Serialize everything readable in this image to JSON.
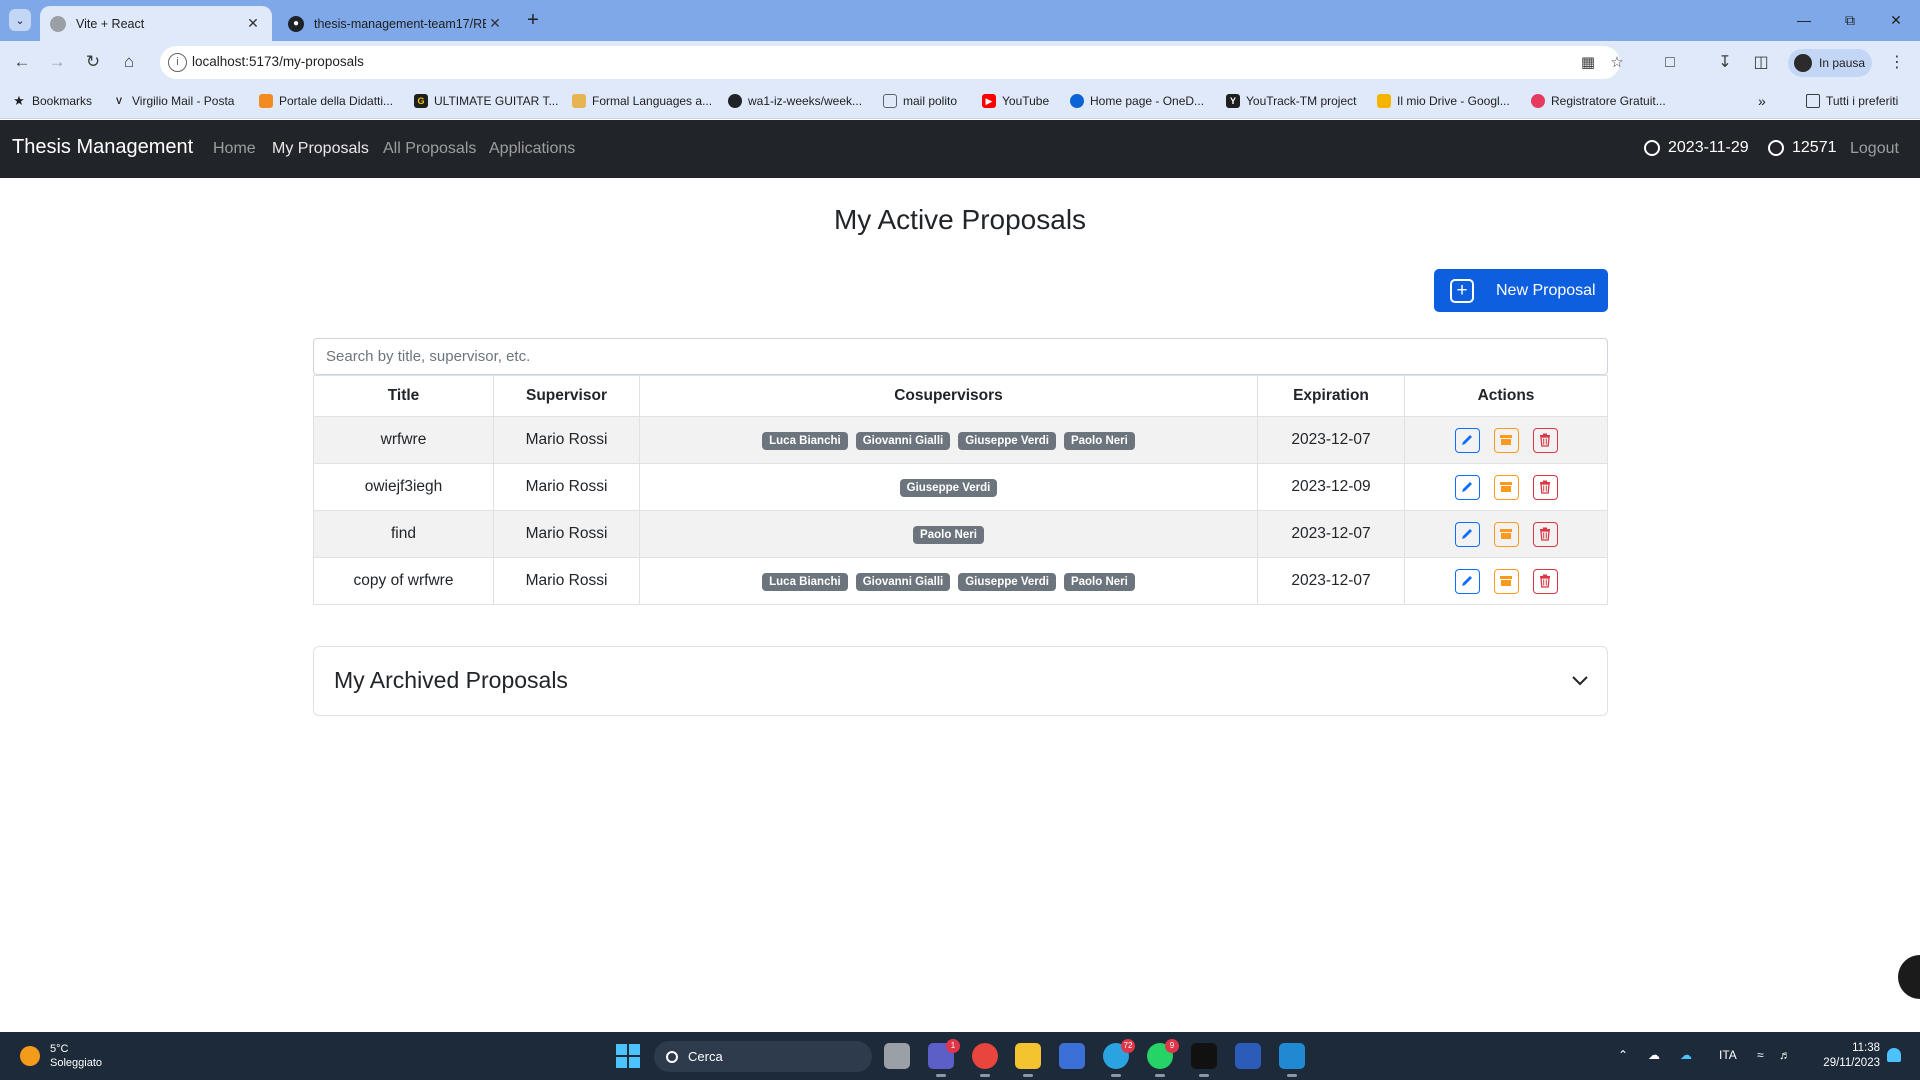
{
  "browser": {
    "tabs": [
      {
        "title": "Vite + React",
        "active": true
      },
      {
        "title": "thesis-management-team17/RE",
        "active": false
      }
    ],
    "url": "localhost:5173/my-proposals",
    "profile_label": "In pausa",
    "bookmarks": [
      {
        "label": "Bookmarks",
        "icon": "star-icon",
        "color": "#1f1f1f"
      },
      {
        "label": "Virgilio Mail - Posta",
        "icon": "virgilio-icon",
        "color": "#1f1f1f"
      },
      {
        "label": "Portale della Didatti...",
        "icon": "portal-icon",
        "color": "#f28b20"
      },
      {
        "label": "ULTIMATE GUITAR T...",
        "icon": "guitar-icon",
        "color": "#1f1f1f"
      },
      {
        "label": "Formal Languages a...",
        "icon": "book-icon",
        "color": "#d33"
      },
      {
        "label": "wa1-iz-weeks/week...",
        "icon": "github-icon",
        "color": "#1f1f1f"
      },
      {
        "label": "mail polito",
        "icon": "mail-icon",
        "color": "#1f1f1f"
      },
      {
        "label": "YouTube",
        "icon": "youtube-icon",
        "color": "#ff0000"
      },
      {
        "label": "Home page - OneD...",
        "icon": "onedrive-icon",
        "color": "#0a64d6"
      },
      {
        "label": "YouTrack-TM project",
        "icon": "youtrack-icon",
        "color": "#1f1f1f"
      },
      {
        "label": "Il mio Drive - Googl...",
        "icon": "drive-icon",
        "color": "#f4b400"
      },
      {
        "label": "Registratore Gratuit...",
        "icon": "recorder-icon",
        "color": "#e53b5d"
      }
    ],
    "all_bookmarks": "Tutti i preferiti"
  },
  "nav": {
    "brand": "Thesis Management",
    "links": [
      "Home",
      "My Proposals",
      "All Proposals",
      "Applications"
    ],
    "active_link": "My Proposals",
    "date": "2023-11-29",
    "user_id": "12571",
    "logout": "Logout"
  },
  "main": {
    "title": "My Active Proposals",
    "new_button": "New Proposal",
    "search_placeholder": "Search by title, supervisor, etc.",
    "columns": [
      "Title",
      "Supervisor",
      "Cosupervisors",
      "Expiration",
      "Actions"
    ],
    "rows": [
      {
        "title": "wrfwre",
        "supervisor": "Mario Rossi",
        "cosupervisors": [
          "Luca Bianchi",
          "Giovanni Gialli",
          "Giuseppe Verdi",
          "Paolo Neri"
        ],
        "expiration": "2023-12-07"
      },
      {
        "title": "owiejf3iegh",
        "supervisor": "Mario Rossi",
        "cosupervisors": [
          "Giuseppe Verdi"
        ],
        "expiration": "2023-12-09"
      },
      {
        "title": "find",
        "supervisor": "Mario Rossi",
        "cosupervisors": [
          "Paolo Neri"
        ],
        "expiration": "2023-12-07"
      },
      {
        "title": "copy of wrfwre",
        "supervisor": "Mario Rossi",
        "cosupervisors": [
          "Luca Bianchi",
          "Giovanni Gialli",
          "Giuseppe Verdi",
          "Paolo Neri"
        ],
        "expiration": "2023-12-07"
      }
    ],
    "archived_title": "My Archived Proposals"
  },
  "taskbar": {
    "weather_temp": "5°C",
    "weather_desc": "Soleggiato",
    "search_label": "Cerca",
    "language": "ITA",
    "time": "11:38",
    "date": "29/11/2023",
    "badges": {
      "teams": "1",
      "telegram": "72",
      "whatsapp": "9"
    }
  },
  "colors": {
    "navbar_bg": "#212529",
    "primary": "#0d5fe0",
    "badge_bg": "#6c757d",
    "edit": "#0d6efd",
    "archive": "#fd9a1e",
    "delete": "#dc3545"
  }
}
